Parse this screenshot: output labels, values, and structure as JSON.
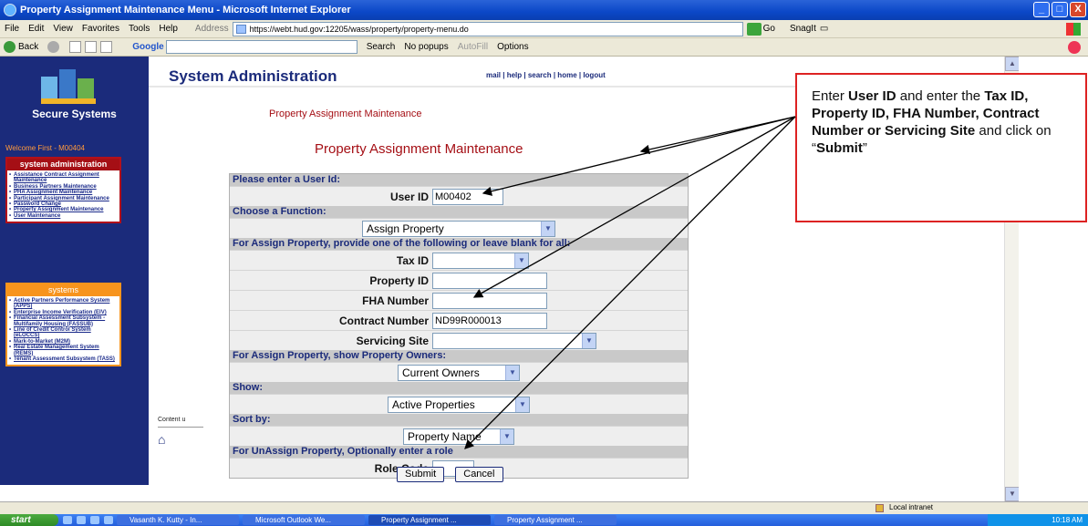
{
  "window": {
    "title": "Property Assignment Maintenance Menu - Microsoft Internet Explorer",
    "min": "_",
    "max": "□",
    "close": "X"
  },
  "menu": [
    "File",
    "Edit",
    "View",
    "Favorites",
    "Tools",
    "Help"
  ],
  "address": {
    "label": "Address",
    "url": "https://webt.hud.gov:12205/wass/property/property-menu.do",
    "go": "Go",
    "snagit": "SnagIt"
  },
  "toolbar": {
    "back": "Back",
    "google": "Google",
    "search": "Search",
    "popups": "No popups",
    "autofill": "AutoFill",
    "options": "Options"
  },
  "sidebar": {
    "brand": "Secure Systems",
    "welcome": "Welcome First - M00404",
    "admin_header": "system administration",
    "admin_items": [
      "Assistance Contract Assignment Maintenance",
      "Business Partners Maintenance",
      "PHA Assignment Maintenance",
      "Participant Assignment Maintenance",
      "Password Change",
      "Property Assignment Maintenance",
      "User Maintenance"
    ],
    "systems_header": "systems",
    "systems_items": [
      "Active Partners Performance System (APPS)",
      "Enterprise Income Verification (EIV)",
      "Financial Assessment Subsystem - Multifamily Housing (FASSUB)",
      "Line of Credit Control System (eLOCCS)",
      "Mark-to-Market (M2M)",
      "Real Estate Management System (REMS)",
      "Tenant Assessment Subsystem (TASS)"
    ]
  },
  "header": {
    "title": "System Administration",
    "links": "mail | help | search | home | logout",
    "subtitle_small": "Property Assignment Maintenance",
    "subtitle_large": "Property Assignment Maintenance",
    "content_u": "Content u"
  },
  "form": {
    "sec_user": "Please enter a User Id:",
    "user_id_label": "User ID",
    "user_id_value": "M00402",
    "sec_function": "Choose a Function:",
    "function_value": "Assign Property",
    "sec_assign": "For Assign Property, provide one of the following or leave blank for all:",
    "tax_id_label": "Tax ID",
    "property_id_label": "Property ID",
    "fha_label": "FHA Number",
    "contract_label": "Contract Number",
    "contract_value": "ND99R000013",
    "servicing_label": "Servicing Site",
    "sec_owners": "For Assign Property, show Property Owners:",
    "owners_value": "Current Owners",
    "sec_show": "Show:",
    "show_value": "Active Properties",
    "sec_sort": "Sort by:",
    "sort_value": "Property Name",
    "sec_unassign": "For UnAssign Property, Optionally enter a role",
    "role_label": "Role Code",
    "submit": "Submit",
    "cancel": "Cancel"
  },
  "callout": {
    "t1": "Enter ",
    "b1": "User ID",
    "t2": " and enter the ",
    "b2": "Tax ID, Property ID, FHA Number, Contract Number or Servicing Site",
    "t3": " and click on “",
    "b3": "Submit",
    "t4": "”"
  },
  "status": {
    "zone": "Local intranet"
  },
  "taskbar": {
    "start": "start",
    "tasks": [
      "Vasanth K. Kutty - In...",
      "Microsoft Outlook We...",
      "Property Assignment ...",
      "Property Assignment ..."
    ],
    "clock": "10:18 AM"
  }
}
